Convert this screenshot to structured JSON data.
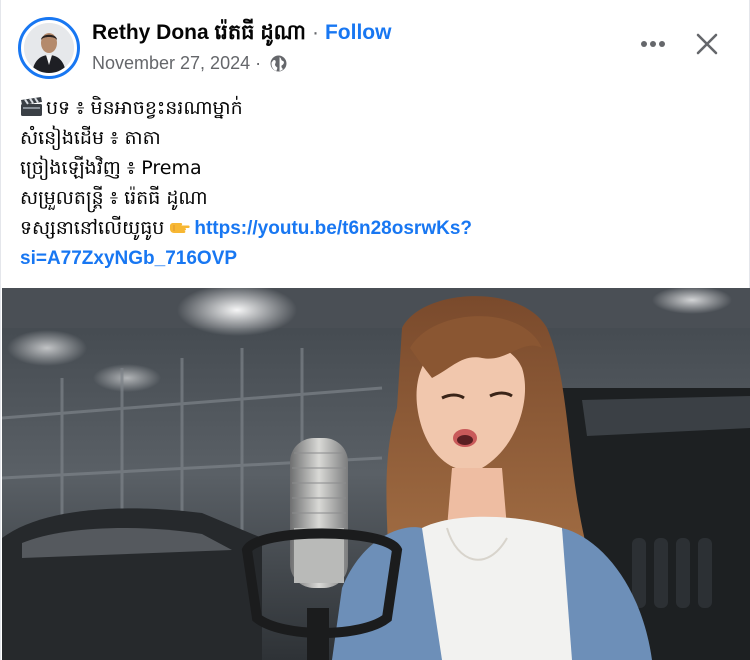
{
  "post": {
    "author_name": "Rethy Dona រ៉េតធី ដូណា",
    "separator": "·",
    "follow_label": "Follow",
    "date": "November 27, 2024",
    "date_separator": "·",
    "audience_icon": "globe-icon",
    "text_lines": [
      "បទ ៖ មិនអាចខ្វះនរណាម្នាក់",
      "សំនៀងដើម ៖ តាតា",
      "ច្រៀងឡើងវិញ ៖ Prema",
      "សម្រួលតន្ត្រី ៖ រ៉េតធី ដូណា",
      "ទស្សនានៅលើយូធូប"
    ],
    "link_part1": "https://youtu.be/t6n28osrwKs?",
    "link_part2": "si=A77ZxyNGb_716OVP"
  },
  "header_actions": {
    "more_icon": "more-horizontal-icon",
    "close_icon": "close-icon"
  },
  "colors": {
    "accent": "#1877f2",
    "secondary_text": "#65676b",
    "primary_text": "#050505"
  }
}
